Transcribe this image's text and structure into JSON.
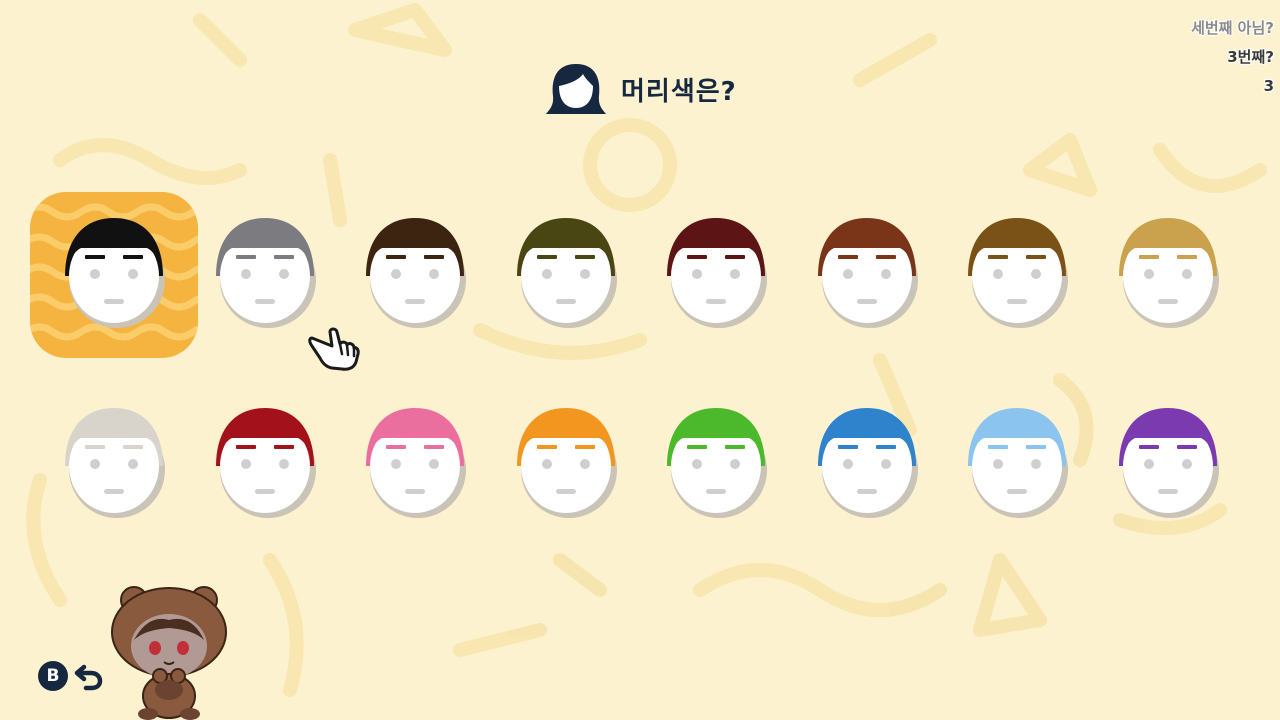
{
  "header": {
    "title": "머리색은?",
    "icon": "hair-icon"
  },
  "chat": {
    "messages": [
      "세번째 아님?",
      "3번째?",
      "3"
    ]
  },
  "hair_colors": {
    "row1": [
      {
        "name": "black",
        "hex": "#111111"
      },
      {
        "name": "gray",
        "hex": "#7b7b80"
      },
      {
        "name": "dark-brown",
        "hex": "#3d2410"
      },
      {
        "name": "olive",
        "hex": "#4a4614"
      },
      {
        "name": "maroon",
        "hex": "#5c1414"
      },
      {
        "name": "auburn",
        "hex": "#7a3518"
      },
      {
        "name": "light-brown",
        "hex": "#7a5218"
      },
      {
        "name": "blonde",
        "hex": "#caa24e"
      }
    ],
    "row2": [
      {
        "name": "white",
        "hex": "#d8d4cc"
      },
      {
        "name": "red",
        "hex": "#a3121a"
      },
      {
        "name": "pink",
        "hex": "#ea6f9f"
      },
      {
        "name": "orange",
        "hex": "#f29620"
      },
      {
        "name": "green",
        "hex": "#4cb82c"
      },
      {
        "name": "blue",
        "hex": "#2f83cc"
      },
      {
        "name": "light-blue",
        "hex": "#8cc4f0"
      },
      {
        "name": "purple",
        "hex": "#7b3ab0"
      }
    ],
    "selected": 0
  },
  "controls": {
    "back_button_label": "B",
    "back_icon": "back-arrow-icon"
  },
  "colors": {
    "background": "#fdf2cf",
    "highlight": "#f5b340",
    "title_text": "#16283f"
  }
}
